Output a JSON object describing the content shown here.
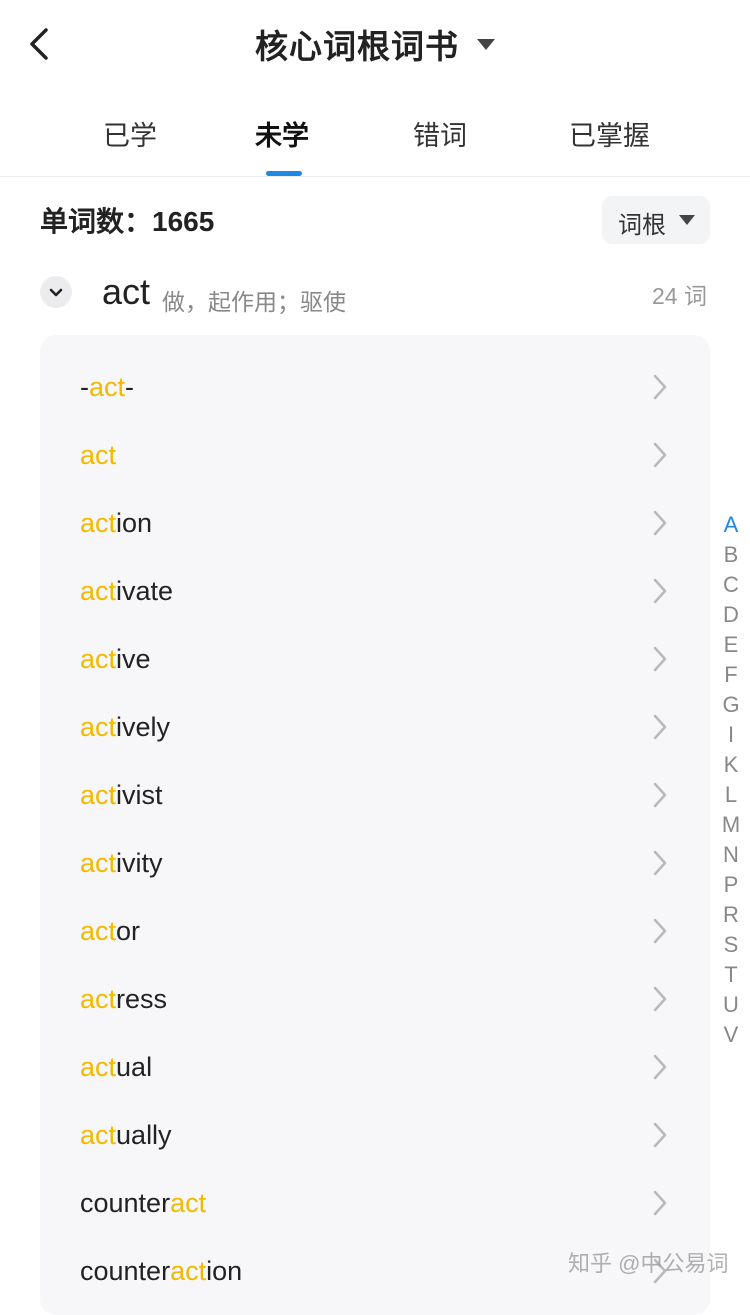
{
  "header": {
    "title": "核心词根词书"
  },
  "tabs": [
    {
      "label": "已学",
      "active": false
    },
    {
      "label": "未学",
      "active": true
    },
    {
      "label": "错词",
      "active": false
    },
    {
      "label": "已掌握",
      "active": false
    }
  ],
  "summary": {
    "count_label": "单词数：1665"
  },
  "sort": {
    "label": "词根"
  },
  "root": {
    "word": "act",
    "meaning": "做，起作用；驱使",
    "count": "24 词"
  },
  "words": [
    {
      "pre": "-",
      "hl": "act",
      "post": "-"
    },
    {
      "pre": "",
      "hl": "act",
      "post": ""
    },
    {
      "pre": "",
      "hl": "act",
      "post": "ion"
    },
    {
      "pre": "",
      "hl": "act",
      "post": "ivate"
    },
    {
      "pre": "",
      "hl": "act",
      "post": "ive"
    },
    {
      "pre": "",
      "hl": "act",
      "post": "ively"
    },
    {
      "pre": "",
      "hl": "act",
      "post": "ivist"
    },
    {
      "pre": "",
      "hl": "act",
      "post": "ivity"
    },
    {
      "pre": "",
      "hl": "act",
      "post": "or"
    },
    {
      "pre": "",
      "hl": "act",
      "post": "ress"
    },
    {
      "pre": "",
      "hl": "act",
      "post": "ual"
    },
    {
      "pre": "",
      "hl": "act",
      "post": "ually"
    },
    {
      "pre": "counter",
      "hl": "act",
      "post": ""
    },
    {
      "pre": "counter",
      "hl": "act",
      "post": "ion"
    }
  ],
  "alphabet": {
    "letters": [
      "A",
      "B",
      "C",
      "D",
      "E",
      "F",
      "G",
      "I",
      "K",
      "L",
      "M",
      "N",
      "P",
      "R",
      "S",
      "T",
      "U",
      "V"
    ],
    "active": "A"
  },
  "watermark": "知乎 @中公易词",
  "colors": {
    "accent": "#1e88e5",
    "highlight": "#f5b800"
  },
  "icons": {
    "back": "chevron-left-icon",
    "dropdown": "caret-down-icon",
    "expand": "chevron-down-icon",
    "row": "chevron-right-icon"
  }
}
